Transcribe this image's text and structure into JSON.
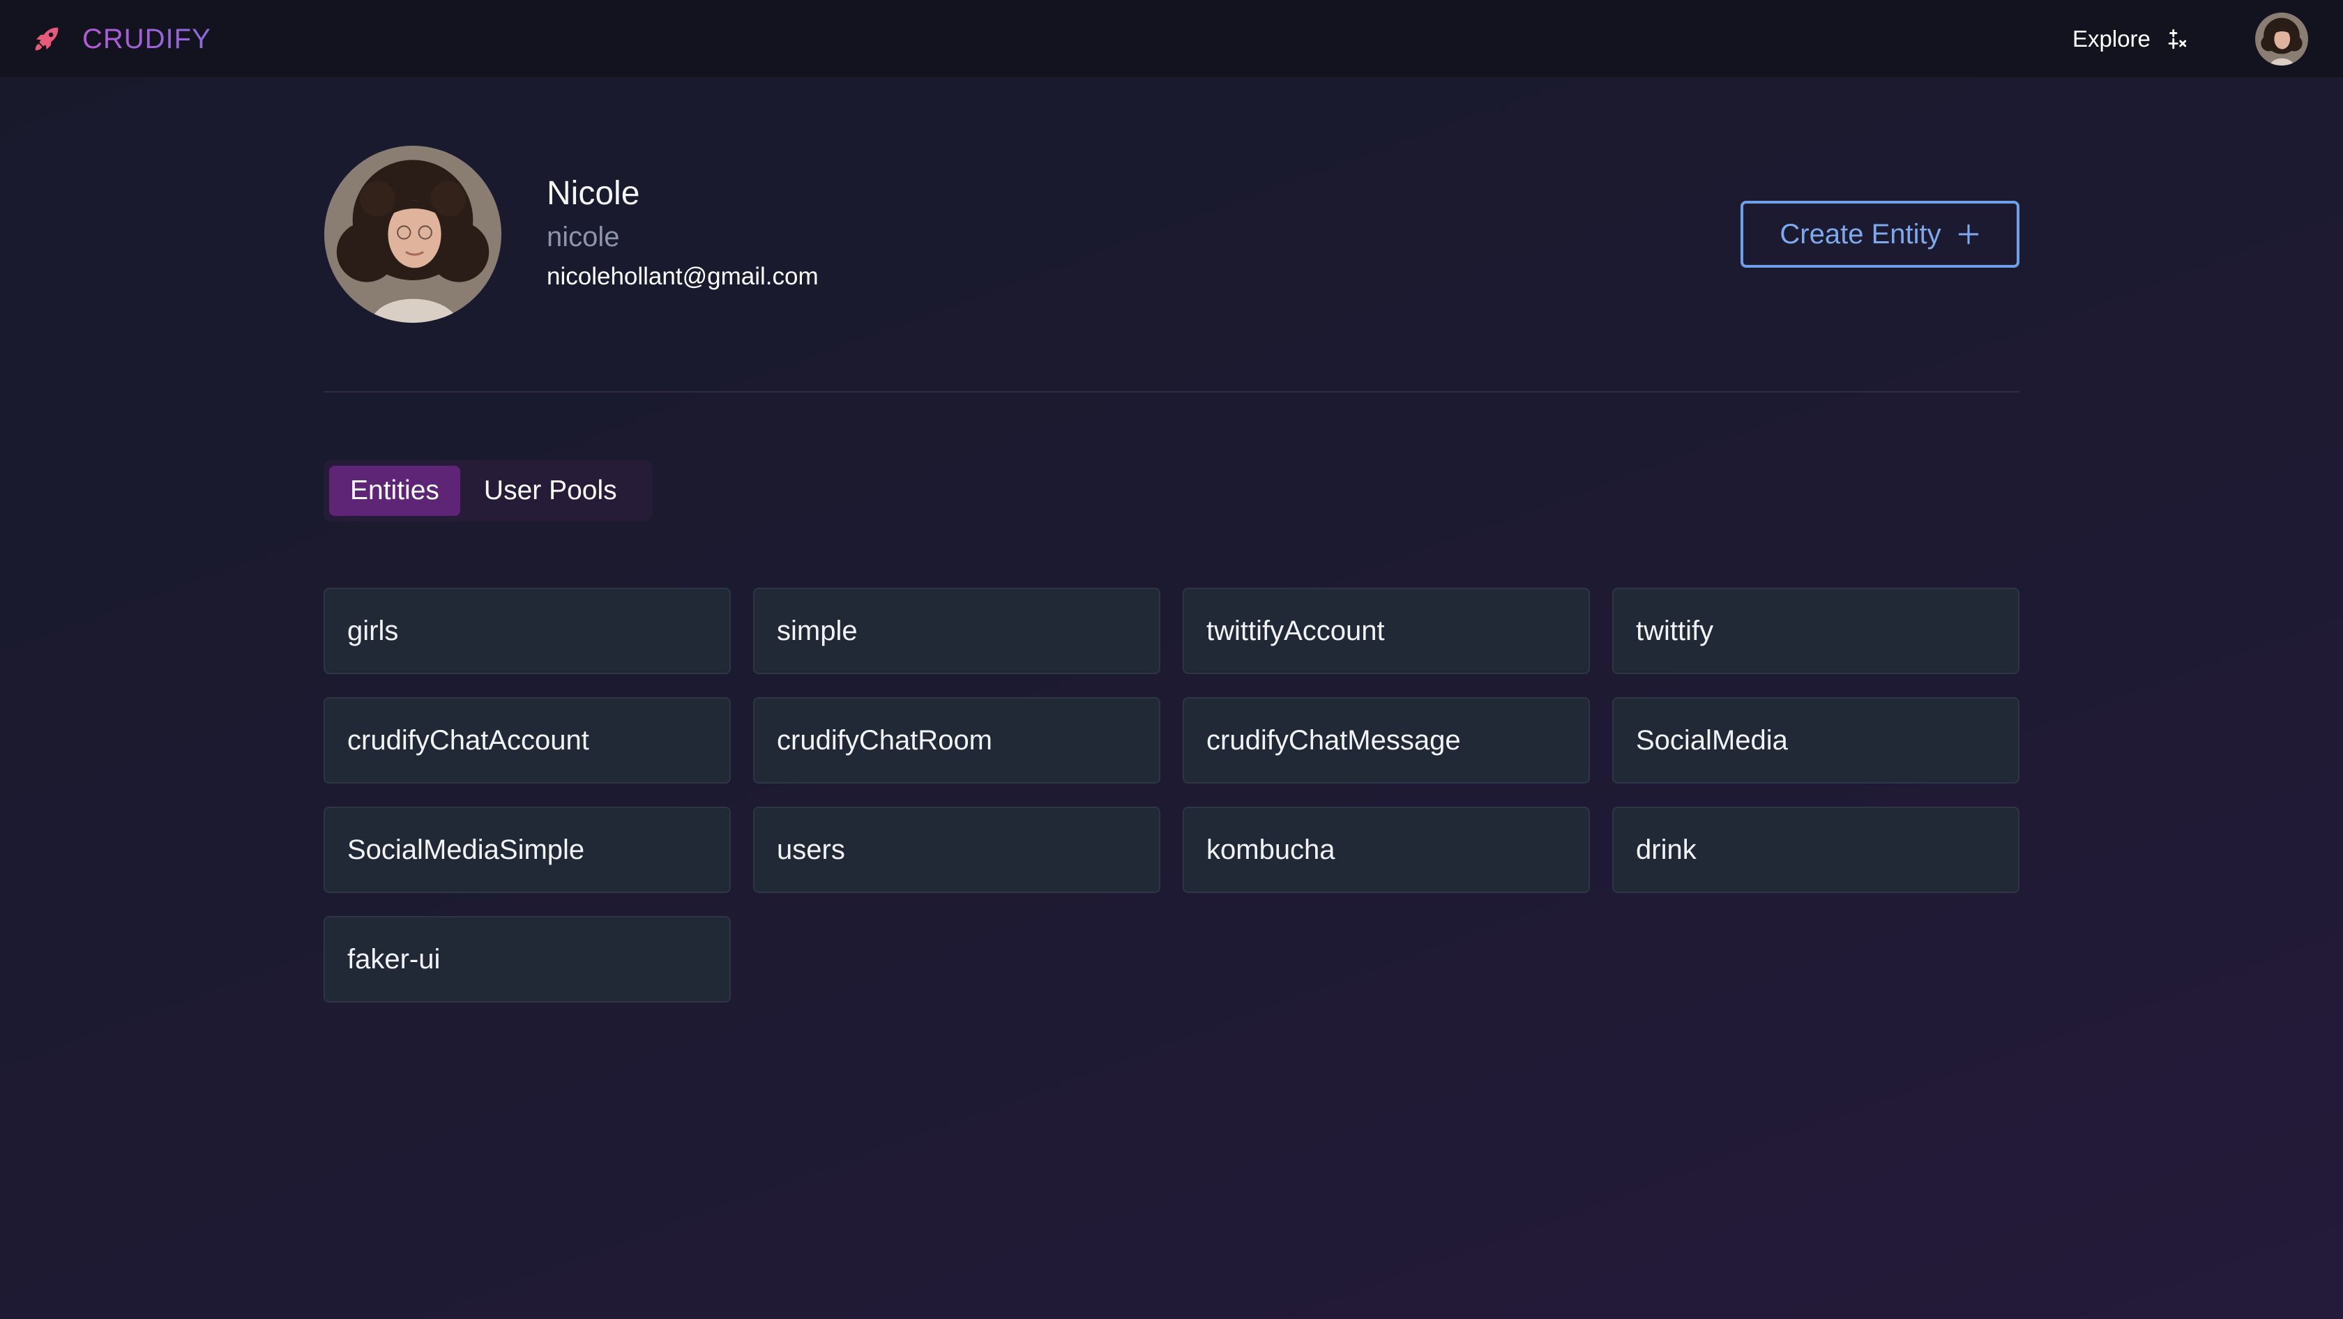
{
  "nav": {
    "brand": "CRUDIFY",
    "brand_icon": "rocket-icon",
    "explore_label": "Explore",
    "explore_icon": "sparkles-icon",
    "avatar_icon": "user-avatar"
  },
  "profile": {
    "name": "Nicole",
    "username": "nicole",
    "email": "nicolehollant@gmail.com",
    "create_button_label": "Create Entity",
    "create_button_icon": "plus-icon"
  },
  "tabs": [
    {
      "label": "Entities",
      "active": true
    },
    {
      "label": "User Pools",
      "active": false
    }
  ],
  "entities": [
    "girls",
    "simple",
    "twittifyAccount",
    "twittify",
    "crudifyChatAccount",
    "crudifyChatRoom",
    "crudifyChatMessage",
    "SocialMedia",
    "SocialMediaSimple",
    "users",
    "kombucha",
    "drink",
    "faker-ui"
  ],
  "colors": {
    "brand_gradient_start": "#b45ad6",
    "brand_gradient_end": "#8b6ad9",
    "rocket": "#e85a7a",
    "accent_blue": "#6f9fe8",
    "active_tab": "#5e2475",
    "card_bg": "#212836"
  }
}
